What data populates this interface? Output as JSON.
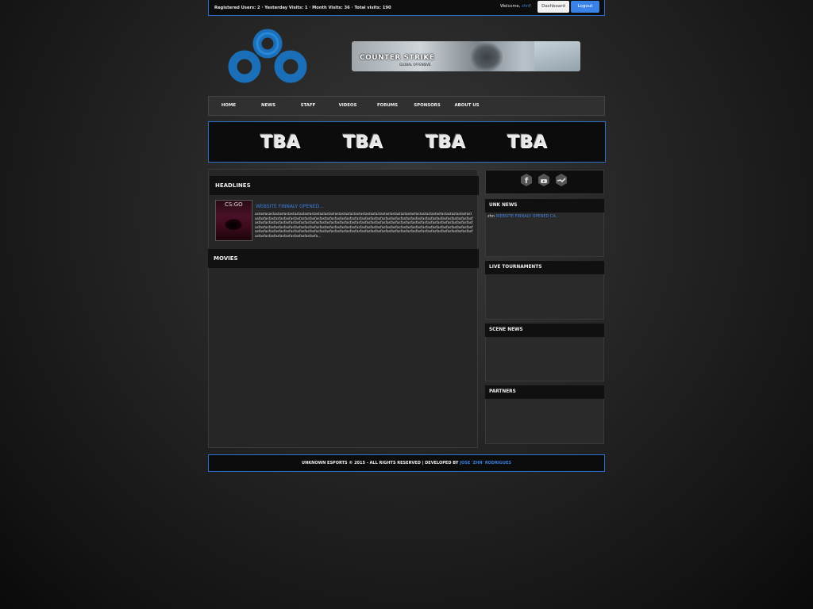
{
  "topbar": {
    "stats": "Registered Users: 2 · Yesterday Visits: 1 · Month Visits: 36 · Total visits: 190",
    "welcome_prefix": "Welcome,",
    "username": "zhn",
    "welcome_suffix": "!",
    "dashboard_label": "Dashboard",
    "logout_label": "Logout"
  },
  "banner": {
    "text": "COUNTER STRIKE",
    "subtext": "GLOBAL OFFENSIVE"
  },
  "nav": {
    "items": [
      "HOME",
      "NEWS",
      "STAFF",
      "VIDEOS",
      "FORUMS",
      "SPONSORS",
      "ABOUT US"
    ]
  },
  "tba": [
    "TBA",
    "TBA",
    "TBA",
    "TBA"
  ],
  "main": {
    "headlines_title": "HEADLINES",
    "movies_title": "MOVIES",
    "news": {
      "thumb_label": "CS:GO",
      "title": "WEBSITE FINNALY OPENED...",
      "body": "asfasfasasfasfasfasfasfasfasfasfasfasfasfasfasfasfasfasfasfasfasfasfasfasfasfasfasfasfasfasfasfasfasfasfasfasfasfasfasfasfasfasfasfasfasfasfasfasfasfasfasfasfasfasfasfasfasfasfasfasfasfasfasfasfasfasfasfasfasfasfasfasfasfasfasfasfasfasfasfasfasfasfasfasfasfasfasfasfasfasfasfasfasfasfasfasfasfasfasfasfasfasfasfasfasfasfasfasfasfasfasfasfasfasfasfasfasfasfasfasfasfasfasfasfasfasfasfasfasfasfasfasfasfasfasfasfasfasfasfasfasfasfasfasfasfasfasfasfasfasfasfasfasfasfasfasfasfasfasfasfasfasfasfasfasfasfasfasfasfasfasfasfasfasfasfasfasfasfasfasfasfasfasfasfasfasfasfasfasfasfasfasfasfasfasfasfasfasfasfasfasfasfasfasfasfasfasfasfasfasfasfasfasfasfasfasfasfasfasfasfasfasfasfasfasfasfa..."
    }
  },
  "sidebar": {
    "social_icons": [
      "facebook-icon",
      "youtube-icon",
      "steam-icon"
    ],
    "unk_news_title": "UNK NEWS",
    "unk_news_user": "zhn",
    "unk_news_link": "WEBSITE FINNALY OPENED CA..",
    "live_tournaments_title": "LIVE TOURNAMENTS",
    "scene_news_title": "SCENE NEWS",
    "partners_title": "PARTNERS"
  },
  "footer": {
    "text": "UNKNOWN ESPORTS © 2015 - ALL RIGHTS RESERVED | DEVELOPED BY",
    "developer": "JOSE 'ZHN' RODRIGUES"
  },
  "colors": {
    "accent": "#3b7fe0",
    "logo": "#1a6fb8"
  }
}
